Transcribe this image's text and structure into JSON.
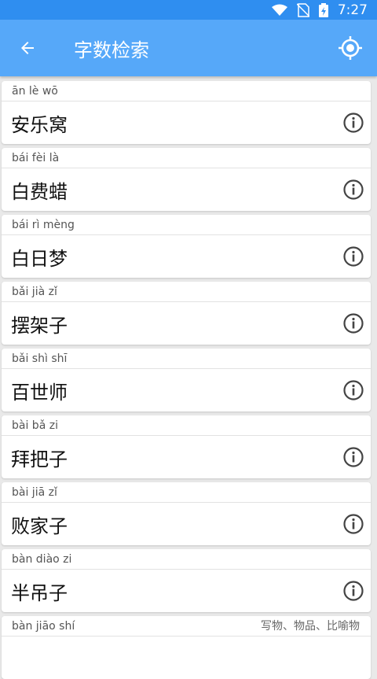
{
  "status": {
    "time": "7:27"
  },
  "appbar": {
    "title": "字数检索"
  },
  "items": [
    {
      "pinyin": "ān lè wō",
      "word": "安乐窝"
    },
    {
      "pinyin": "bái fèi là",
      "word": "白费蜡"
    },
    {
      "pinyin": "bái rì mèng",
      "word": "白日梦"
    },
    {
      "pinyin": "bǎi jià zǐ",
      "word": "摆架子"
    },
    {
      "pinyin": "bǎi shì shī",
      "word": "百世师"
    },
    {
      "pinyin": "bài bǎ zi",
      "word": "拜把子"
    },
    {
      "pinyin": "bài jiā zǐ",
      "word": "败家子"
    },
    {
      "pinyin": "bàn diào zi",
      "word": "半吊子"
    },
    {
      "pinyin": "bàn jiāo shí",
      "word": "",
      "note": "写物、物品、比喻物"
    }
  ],
  "colors": {
    "statusbar": "#2f8ef0",
    "appbar": "#56a8f9"
  },
  "icons": {
    "back": "arrow-left-icon",
    "locate": "crosshair-icon",
    "info": "info-circle-icon"
  }
}
